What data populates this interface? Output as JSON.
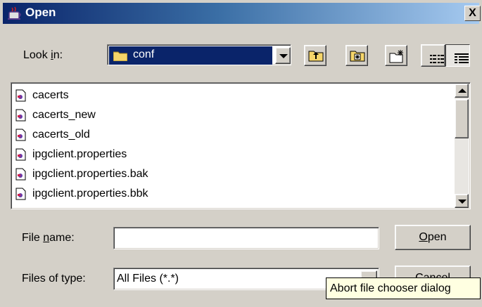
{
  "window": {
    "title": "Open",
    "close_label": "X"
  },
  "look_in": {
    "label_pre": "Look ",
    "label_mnemonic": "i",
    "label_post": "n:",
    "value": "conf"
  },
  "toolbar": {
    "up": "up-one-level-icon",
    "home": "home-icon",
    "new_folder": "new-folder-icon",
    "list": "list-view-icon",
    "details": "details-view-icon"
  },
  "files": [
    "cacerts",
    "cacerts_new",
    "cacerts_old",
    "ipgclient.properties",
    "ipgclient.properties.bak",
    "ipgclient.properties.bbk"
  ],
  "file_name": {
    "label_pre": "File ",
    "label_mnemonic": "n",
    "label_post": "ame:",
    "value": ""
  },
  "file_type": {
    "label": "Files of type:",
    "value": "All Files (*.*)"
  },
  "buttons": {
    "open_mnemonic": "O",
    "open_rest": "pen",
    "cancel": "Cancel"
  },
  "tooltip": "Abort file chooser dialog",
  "colors": {
    "title_start": "#0a246a",
    "title_end": "#a6caf0",
    "selection": "#0a246a",
    "face": "#d4d0c8",
    "tooltip_bg": "#ffffe1"
  }
}
